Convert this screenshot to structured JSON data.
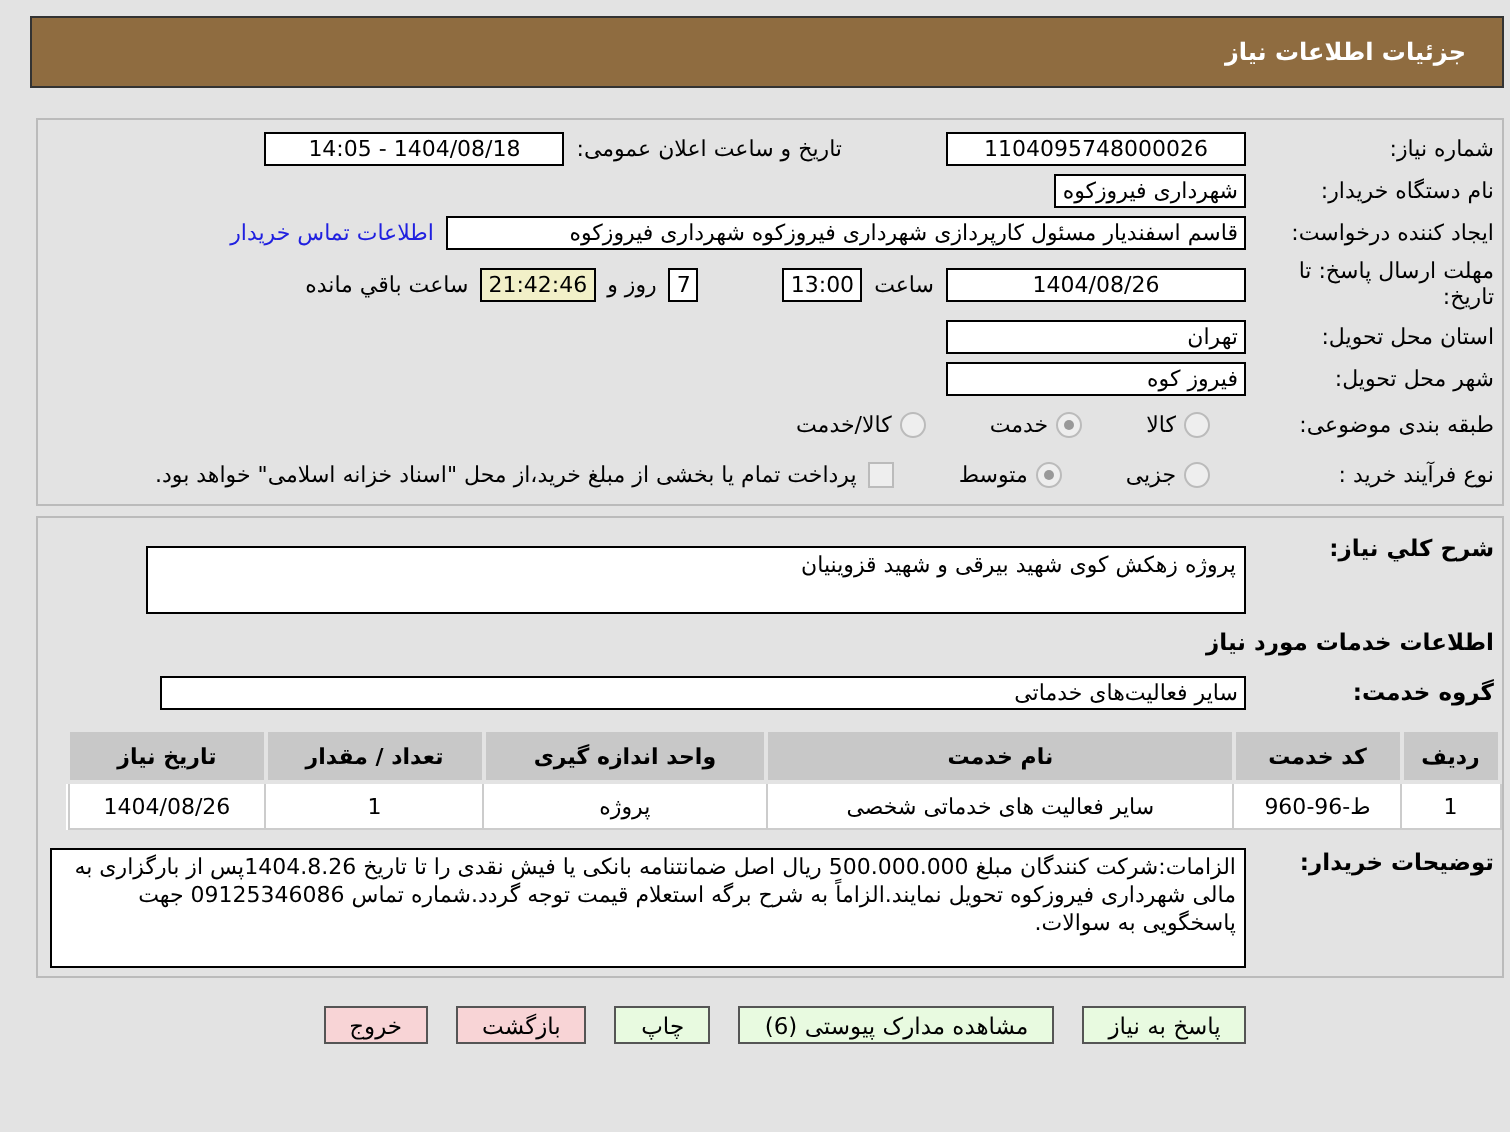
{
  "header": {
    "title": "جزئیات اطلاعات نیاز"
  },
  "need_number": {
    "label": "شماره نیاز:",
    "value": "1104095748000026"
  },
  "announce": {
    "label": "تاریخ و ساعت اعلان عمومی:",
    "value": "1404/08/18 - 14:05"
  },
  "buyer_org": {
    "label": "نام دستگاه خریدار:",
    "value": "شهرداری فیروزکوه"
  },
  "requester": {
    "label": "ایجاد کننده درخواست:",
    "value": "قاسم اسفندیار مسئول کارپردازی شهرداری فیروزکوه شهرداری فیروزکوه",
    "link": "اطلاعات تماس خریدار"
  },
  "deadline": {
    "label": "مهلت ارسال پاسخ: تا تاریخ:",
    "date": "1404/08/26",
    "time_label": "ساعت",
    "time": "13:00",
    "days": "7",
    "days_label": "روز و",
    "remaining": "21:42:46",
    "remaining_label": "ساعت باقي مانده"
  },
  "province": {
    "label": "استان محل تحویل:",
    "value": "تهران"
  },
  "city": {
    "label": "شهر محل تحویل:",
    "value": "فیروز کوه"
  },
  "category": {
    "label": "طبقه بندی موضوعی:",
    "options": [
      {
        "label": "کالا",
        "selected": false
      },
      {
        "label": "خدمت",
        "selected": true
      },
      {
        "label": "کالا/خدمت",
        "selected": false
      }
    ]
  },
  "process": {
    "label": "نوع فرآیند خرید :",
    "options": [
      {
        "label": "جزیی",
        "selected": false
      },
      {
        "label": "متوسط",
        "selected": true
      }
    ],
    "payment_check": {
      "checked": false,
      "label": "پرداخت تمام یا بخشی از مبلغ خرید،از محل \"اسناد خزانه اسلامی\" خواهد بود."
    }
  },
  "description": {
    "label": "شرح کلي نیاز:",
    "value": "پروژه زهکش کوی شهید بیرقی و شهید قزوینیان"
  },
  "services_heading": "اطلاعات خدمات مورد نیاز",
  "service_group": {
    "label": "گروه خدمت:",
    "value": "سایر فعالیت‌های خدماتی"
  },
  "table": {
    "columns": [
      "ردیف",
      "کد خدمت",
      "نام خدمت",
      "واحد اندازه گیری",
      "تعداد / مقدار",
      "تاریخ نیاز"
    ],
    "rows": [
      [
        "1",
        "ط-96-960",
        "سایر فعالیت های خدماتی شخصی",
        "پروژه",
        "1",
        "1404/08/26"
      ]
    ]
  },
  "buyer_notes": {
    "label": "توضیحات خریدار:",
    "value": "الزامات:شرکت کنندگان مبلغ 500.000.000 ریال اصل ضمانتنامه بانکی یا فیش نقدی را تا تاریخ 1404.8.26پس از بارگزاری به مالی شهرداری فیروزکوه تحویل نمایند.الزاماً به شرح برگه استعلام قیمت توجه گردد.شماره تماس 09125346086 جهت پاسخگویی به سوالات."
  },
  "buttons": [
    {
      "label": "پاسخ به نیاز",
      "kind": "primary"
    },
    {
      "label": "مشاهده مدارک پیوستی (6)",
      "kind": "primary"
    },
    {
      "label": "چاپ",
      "kind": "primary"
    },
    {
      "label": "بازگشت",
      "kind": "danger"
    },
    {
      "label": "خروج",
      "kind": "danger"
    }
  ]
}
